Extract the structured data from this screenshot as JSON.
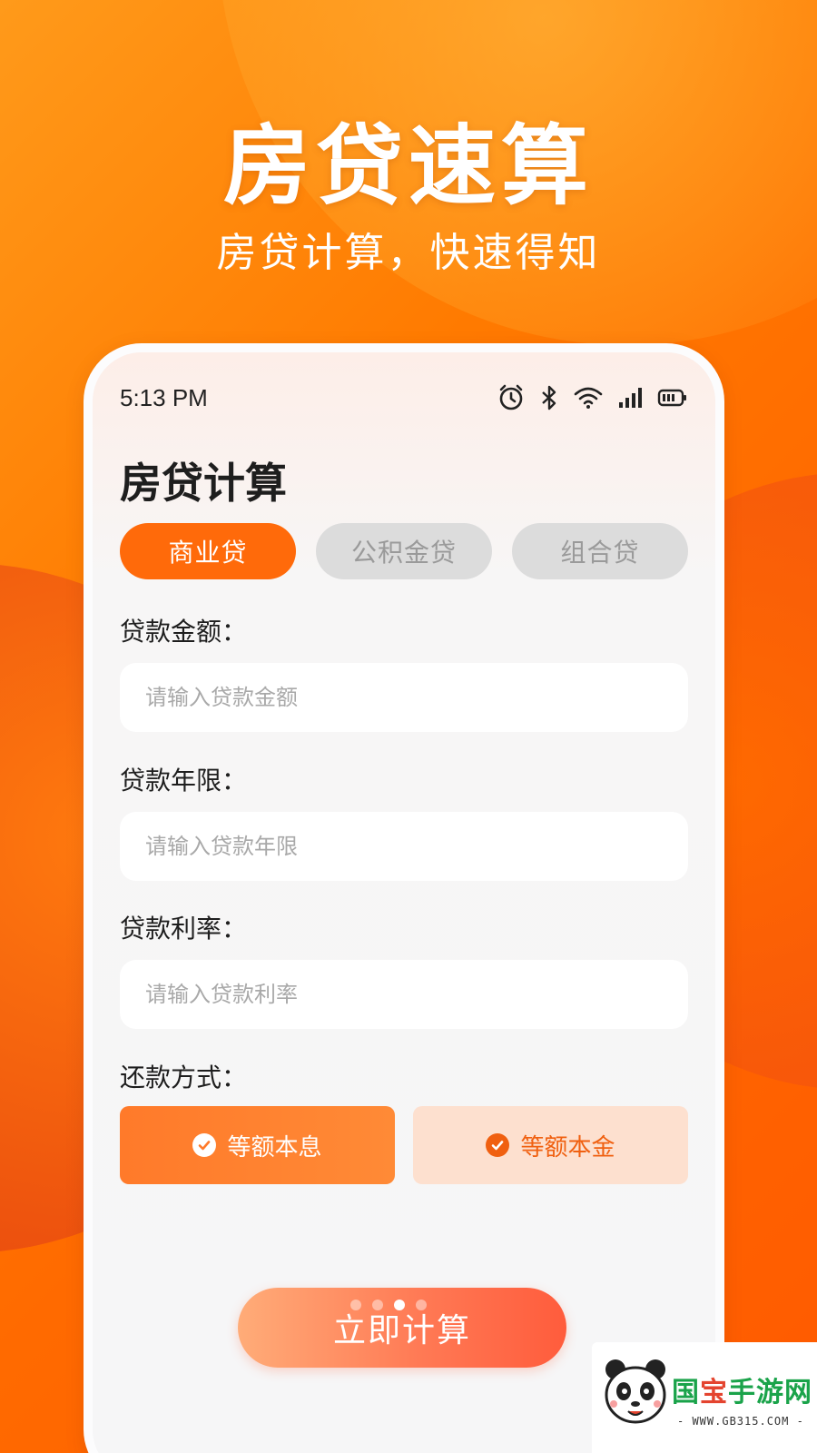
{
  "hero": {
    "title": "房贷速算",
    "subtitle": "房贷计算，快速得知"
  },
  "status_bar": {
    "time": "5:13 PM",
    "icons": [
      "alarm-icon",
      "bluetooth-icon",
      "wifi-icon",
      "signal-icon",
      "battery-icon"
    ]
  },
  "app": {
    "title": "房贷计算",
    "tabs": [
      {
        "label": "商业贷",
        "active": true
      },
      {
        "label": "公积金贷",
        "active": false
      },
      {
        "label": "组合贷",
        "active": false
      }
    ],
    "fields": [
      {
        "label": "贷款金额：",
        "placeholder": "请输入贷款金额",
        "value": ""
      },
      {
        "label": "贷款年限：",
        "placeholder": "请输入贷款年限",
        "value": ""
      },
      {
        "label": "贷款利率：",
        "placeholder": "请输入贷款利率",
        "value": ""
      }
    ],
    "repayment": {
      "label": "还款方式：",
      "options": [
        {
          "label": "等额本息",
          "selected": true
        },
        {
          "label": "等额本金",
          "selected": false
        }
      ]
    },
    "calculate_label": "立即计算",
    "pager": {
      "count": 4,
      "active_index": 2
    }
  },
  "watermark": {
    "name_part1": "国",
    "name_part2": "宝",
    "name_part3": "手游网",
    "url": "- WWW.GB315.COM -"
  },
  "colors": {
    "accent": "#ff6a0a",
    "background": "#ff7a00",
    "tab_inactive": "#dcdcdc"
  }
}
